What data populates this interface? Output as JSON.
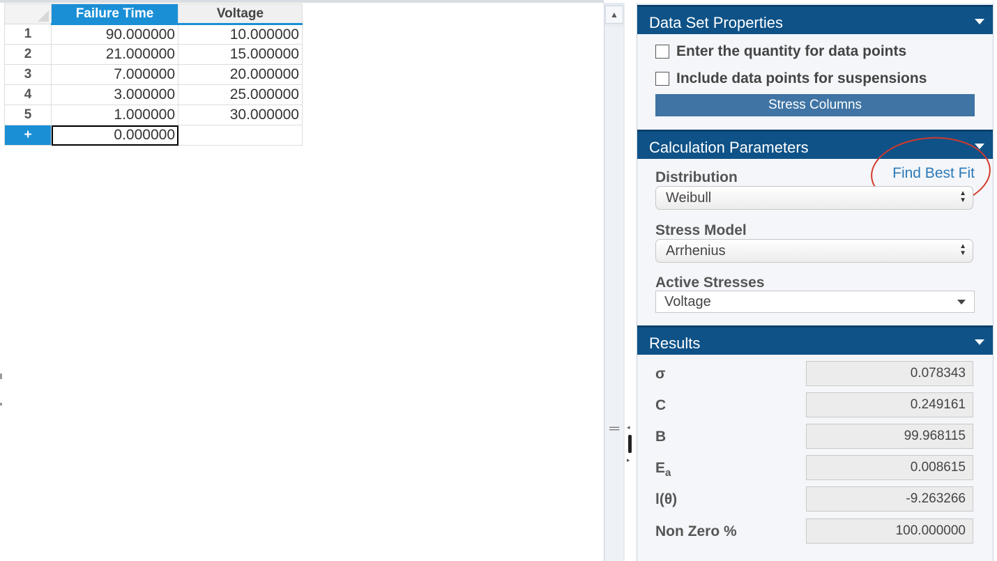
{
  "grid": {
    "columns": [
      "Failure Time",
      "Voltage"
    ],
    "rows": [
      {
        "id": "1",
        "failure_time": "90.000000",
        "voltage": "10.000000"
      },
      {
        "id": "2",
        "failure_time": "21.000000",
        "voltage": "15.000000"
      },
      {
        "id": "3",
        "failure_time": "7.000000",
        "voltage": "20.000000"
      },
      {
        "id": "4",
        "failure_time": "3.000000",
        "voltage": "25.000000"
      },
      {
        "id": "5",
        "failure_time": "1.000000",
        "voltage": "30.000000"
      }
    ],
    "new_row": {
      "marker": "+",
      "failure_time": "0.000000",
      "voltage": ""
    }
  },
  "panel": {
    "data_set": {
      "title": "Data Set Properties",
      "quantity_label": "Enter the quantity for data points",
      "suspensions_label": "Include data points for suspensions",
      "stress_columns_button": "Stress Columns"
    },
    "calculation": {
      "title": "Calculation Parameters",
      "distribution_label": "Distribution",
      "find_best_fit": "Find Best Fit",
      "distribution_value": "Weibull",
      "stress_model_label": "Stress Model",
      "stress_model_value": "Arrhenius",
      "active_stresses_label": "Active Stresses",
      "active_stresses_value": "Voltage"
    },
    "results": {
      "title": "Results",
      "items": [
        {
          "label": "σ",
          "value": "0.078343"
        },
        {
          "label": "C",
          "value": "0.249161"
        },
        {
          "label": "B",
          "value": "99.968115"
        },
        {
          "label": "E",
          "sub": "a",
          "value": "0.008615"
        },
        {
          "label": "l(θ)",
          "value": "-9.263266"
        },
        {
          "label": "Non Zero %",
          "value": "100.000000"
        }
      ]
    }
  },
  "colors": {
    "header_blue": "#0e5287",
    "selection_blue": "#1a8fd6",
    "button_blue": "#3f74a4",
    "link_blue": "#2b79b6",
    "annotation_red": "#d4382c"
  }
}
